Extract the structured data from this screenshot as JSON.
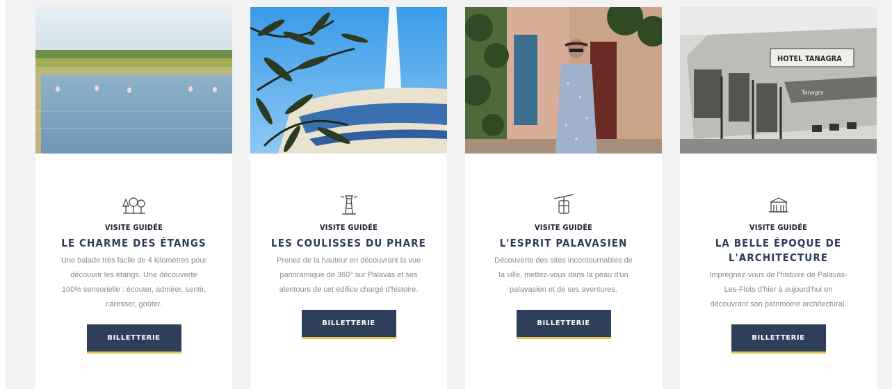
{
  "cards": [
    {
      "image_alt": "Flamingos on the lagoon",
      "icon": "trees-icon",
      "kicker": "Visite guidée",
      "title": "LE CHARME DES ÉTANGS",
      "description": "Une balade très facile de 4 kilomètres pour découvrir les étangs. Une découverte 100% sensorielle : écouter, admirer, sentir, caresser, goûter.",
      "button": "BILLETTERIE"
    },
    {
      "image_alt": "Olive branches and lighthouse",
      "icon": "lighthouse-icon",
      "kicker": "Visite guidée",
      "title": "LES COULISSES DU PHARE",
      "description": "Prenez de la hauteur en découvrant la vue panoramique de 360° sur Palavas et ses alentours de cet édifice chargé d'histoire.",
      "button": "BILLETTERIE"
    },
    {
      "image_alt": "Woman walking in a street",
      "icon": "cable-car-icon",
      "kicker": "Visite guidée",
      "title": "L'ESPRIT PALAVASIEN",
      "description": "Découverte des sites incontournables de la ville, mettez-vous dans la peau d'un palavasien et de ses aventures.",
      "button": "BILLETTERIE"
    },
    {
      "image_alt": "Old photo of a hotel",
      "icon": "building-icon",
      "kicker": "Visite guidée",
      "title": "LA BELLE ÉPOQUE DE L'ARCHITECTURE",
      "description": "Imprégnez-vous de l'histoire de Palavas-Les-Flots d'hier à aujourd'hui en découvrant son patrimoine architectural.",
      "button": "BILLETTERIE",
      "photo_signs": [
        "HOTEL TANAGRA",
        "Tanagra"
      ]
    }
  ],
  "colors": {
    "accent": "#2e3f5a",
    "button_underline": "#e9c347",
    "title": "#2d3a5a"
  }
}
